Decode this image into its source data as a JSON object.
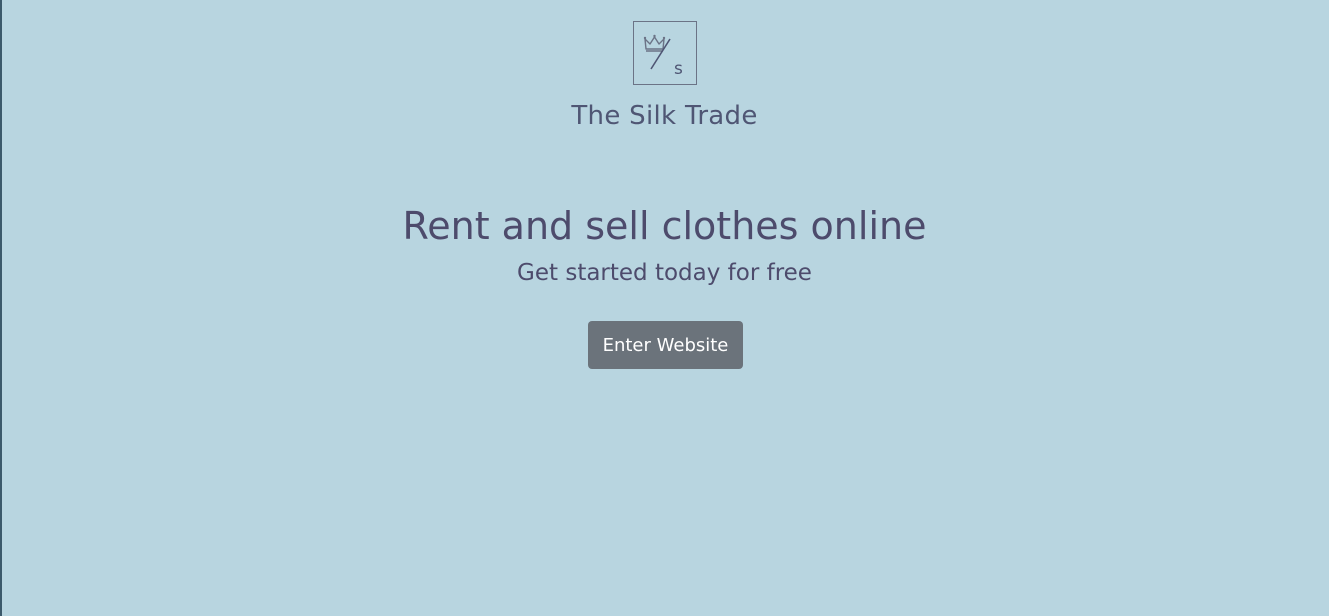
{
  "brand": {
    "logo_icon": "crown-slash-s-logo",
    "logo_letter": "s",
    "name": "The Silk Trade"
  },
  "hero": {
    "headline": "Rent and sell clothes online",
    "subhead": "Get started today for free",
    "cta_label": "Enter Website"
  },
  "colors": {
    "background": "#b8d5e0",
    "text": "#4d4b6c",
    "button": "#6b737b",
    "button_text": "#ffffff",
    "logo_stroke": "#6b7386"
  }
}
